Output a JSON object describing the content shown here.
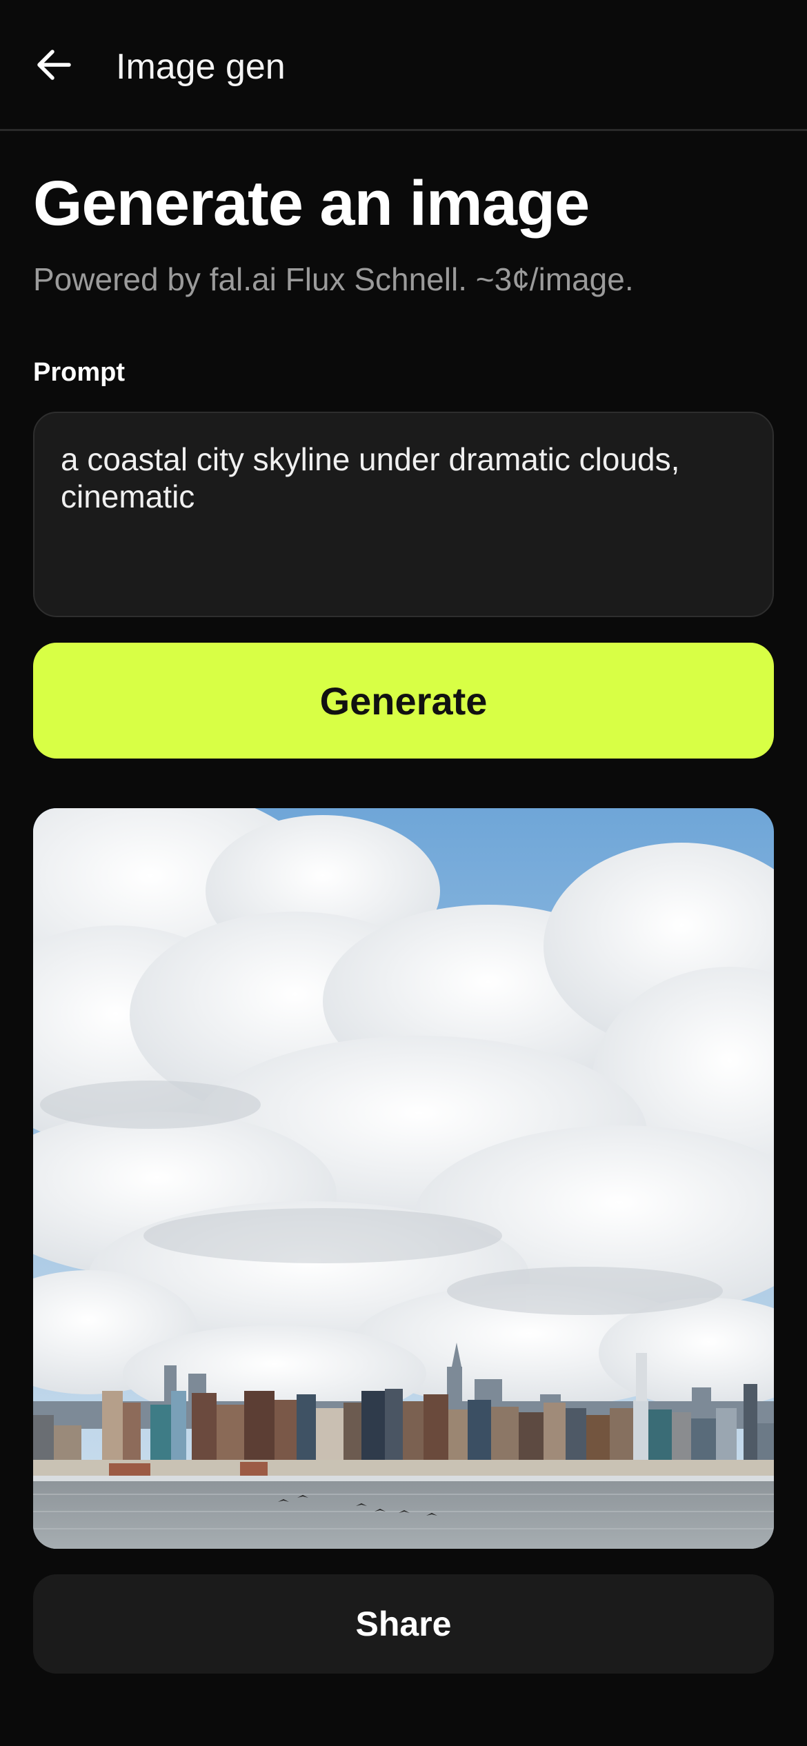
{
  "header": {
    "back_icon": "arrow-left-icon",
    "title": "Image gen"
  },
  "main": {
    "title": "Generate an image",
    "subtitle": "Powered by fal.ai Flux Schnell. ~3¢/image.",
    "prompt_label": "Prompt",
    "prompt_value": "a coastal city skyline under dramatic clouds, cinematic",
    "generate_label": "Generate",
    "share_label": "Share"
  },
  "colors": {
    "background": "#0a0a0a",
    "accent": "#d8ff45",
    "surface": "#1b1b1b",
    "muted_text": "#9b9b9b"
  }
}
